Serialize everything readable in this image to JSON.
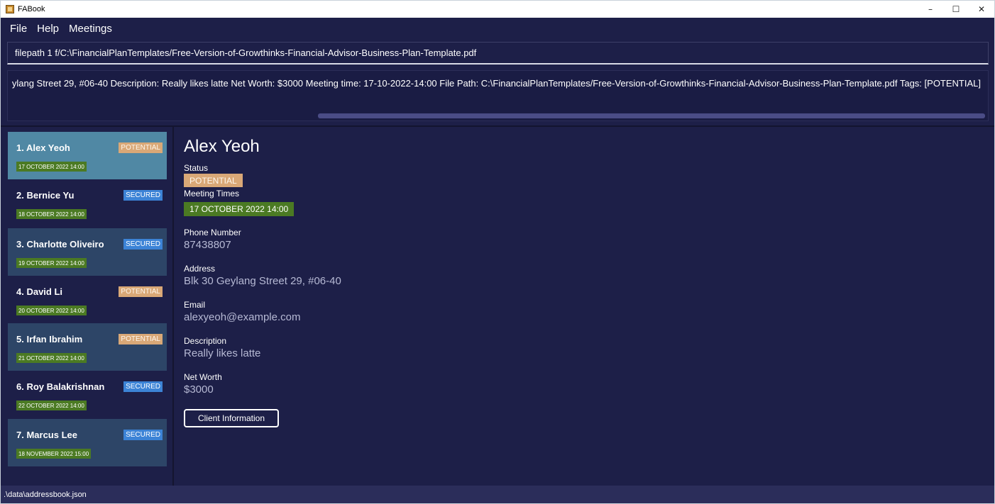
{
  "window": {
    "title": "FABook",
    "minimize": "–",
    "maximize": "☐",
    "close": "✕"
  },
  "menu": {
    "items": [
      "File",
      "Help",
      "Meetings"
    ]
  },
  "command": {
    "value": "filepath 1 f/C:\\FinancialPlanTemplates/Free-Version-of-Growthinks-Financial-Advisor-Business-Plan-Template.pdf"
  },
  "result": {
    "text": "ylang Street 29, #06-40 Description: Really likes latte Net Worth: $3000 Meeting time: 17-10-2022-14:00 File Path: C:\\FinancialPlanTemplates/Free-Version-of-Growthinks-Financial-Advisor-Business-Plan-Template.pdf Tags: [POTENTIAL]"
  },
  "persons": [
    {
      "name": "1.  Alex Yeoh",
      "status": "POTENTIAL",
      "meeting": "17 OCTOBER 2022 14:00"
    },
    {
      "name": "2.  Bernice Yu",
      "status": "SECURED",
      "meeting": "18 OCTOBER 2022 14:00"
    },
    {
      "name": "3.  Charlotte Oliveiro",
      "status": "SECURED",
      "meeting": "19 OCTOBER 2022 14:00"
    },
    {
      "name": "4.  David Li",
      "status": "POTENTIAL",
      "meeting": "20 OCTOBER 2022 14:00"
    },
    {
      "name": "5.  Irfan Ibrahim",
      "status": "POTENTIAL",
      "meeting": "21 OCTOBER 2022 14:00"
    },
    {
      "name": "6.  Roy Balakrishnan",
      "status": "SECURED",
      "meeting": "22 OCTOBER 2022 14:00"
    },
    {
      "name": "7.  Marcus Lee",
      "status": "SECURED",
      "meeting": "18 NOVEMBER 2022 15:00"
    }
  ],
  "detail": {
    "name": "Alex Yeoh",
    "status_label": "Status",
    "status": "POTENTIAL",
    "meeting_label": "Meeting Times",
    "meeting": "17 OCTOBER 2022 14:00",
    "phone_label": "Phone Number",
    "phone": "87438807",
    "address_label": "Address",
    "address": "Blk 30 Geylang Street 29, #06-40",
    "email_label": "Email",
    "email": "alexyeoh@example.com",
    "description_label": "Description",
    "description": "Really likes latte",
    "networth_label": "Net Worth",
    "networth": "$3000",
    "client_button": "Client Information"
  },
  "statusbar": {
    "path": ".\\data\\addressbook.json"
  },
  "colors": {
    "background": "#1d1f48",
    "selected_card": "#5088a4",
    "alt_card": "#2d4567",
    "potential": "#d9a877",
    "secured": "#3c83d6",
    "meeting": "#4b7a23"
  }
}
